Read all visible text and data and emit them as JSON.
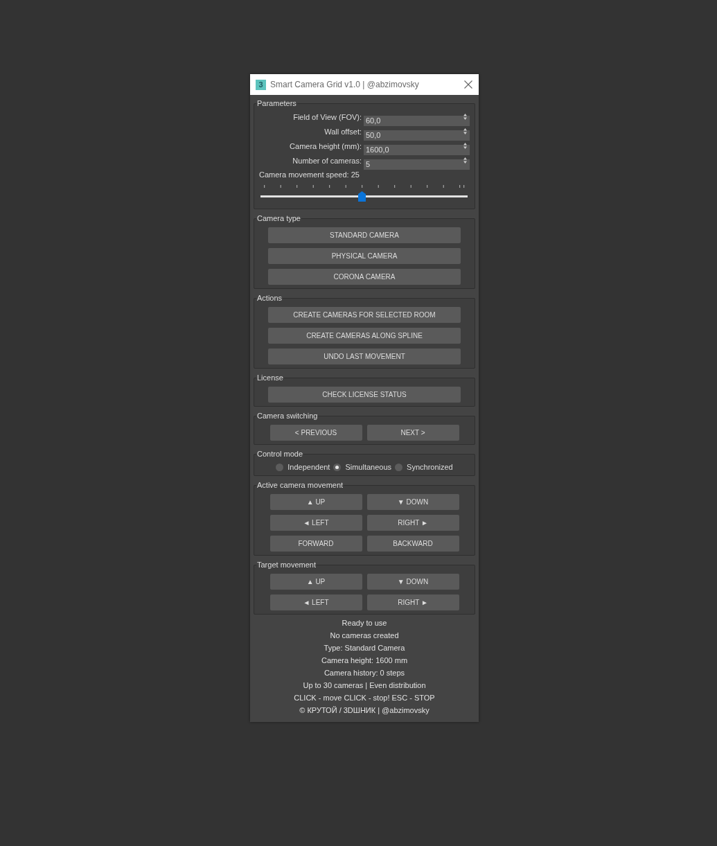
{
  "window": {
    "app_logo": "3",
    "title": "Smart Camera Grid v1.0 | @abzimovsky"
  },
  "groups": [
    {
      "kind": "parameters",
      "label": "Parameters",
      "fields": [
        {
          "label": "Field of View (FOV):",
          "value": "60,0"
        },
        {
          "label": "Wall offset:",
          "value": "50,0"
        },
        {
          "label": "Camera height (mm):",
          "value": "1600,0"
        },
        {
          "label": "Number of cameras:",
          "value": "5"
        }
      ],
      "speed": {
        "label": "Camera movement speed: 25",
        "level": 0.49
      }
    },
    {
      "kind": "buttons",
      "label": "Camera type",
      "buttons": [
        "STANDARD CAMERA",
        "PHYSICAL CAMERA",
        "CORONA CAMERA"
      ]
    },
    {
      "kind": "buttons",
      "label": "Actions",
      "buttons": [
        "CREATE CAMERAS FOR SELECTED ROOM",
        "CREATE CAMERAS ALONG SPLINE",
        "UNDO LAST MOVEMENT"
      ]
    },
    {
      "kind": "buttons",
      "label": "License",
      "buttons": [
        "CHECK LICENSE STATUS"
      ]
    },
    {
      "kind": "button_grid",
      "label": "Camera switching",
      "buttons": [
        "< PREVIOUS",
        "NEXT >"
      ]
    },
    {
      "kind": "radios",
      "label": "Control mode",
      "options": [
        {
          "label": "Independent",
          "selected": false
        },
        {
          "label": "Simultaneous",
          "selected": true
        },
        {
          "label": "Synchronized",
          "selected": false
        }
      ]
    },
    {
      "kind": "button_grid",
      "label": "Active camera movement",
      "buttons": [
        "▲ UP",
        "▼ DOWN",
        "◄ LEFT",
        "RIGHT ►",
        "FORWARD",
        "BACKWARD"
      ]
    },
    {
      "kind": "button_grid",
      "label": "Target movement",
      "buttons": [
        "▲ UP",
        "▼ DOWN",
        "◄ LEFT",
        "RIGHT ►"
      ]
    }
  ],
  "status_lines": [
    "Ready to use",
    "No cameras created",
    "Type: Standard Camera",
    "Camera height: 1600 mm",
    "Camera history: 0 steps",
    "Up to 30 cameras | Even distribution",
    "CLICK - move CLICK - stop! ESC - STOP",
    "© КРУТОЙ / 3DШНИК | @abzimovsky"
  ]
}
